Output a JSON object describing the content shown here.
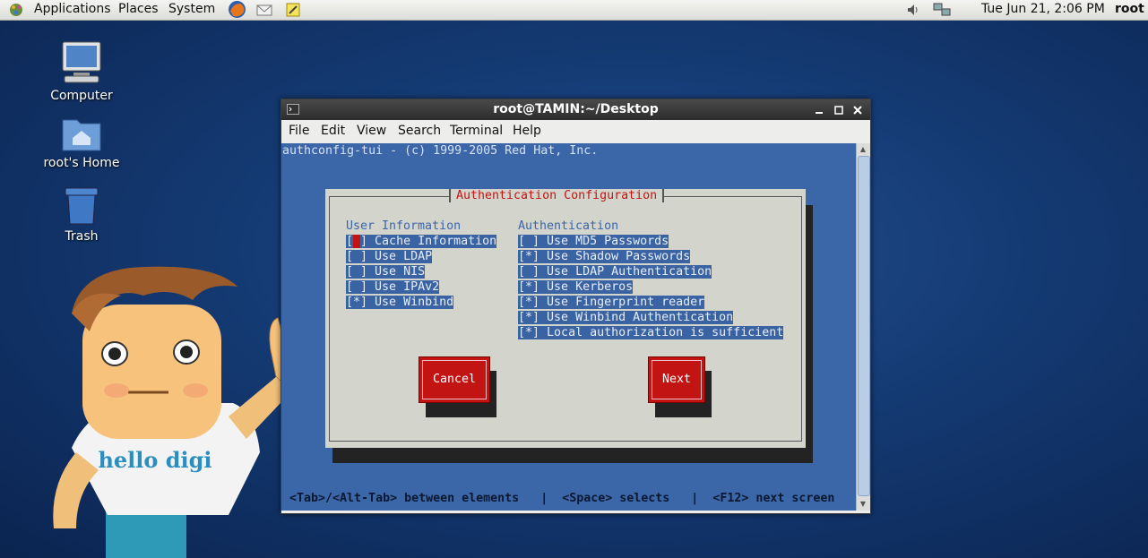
{
  "panel": {
    "menus": [
      "Applications",
      "Places",
      "System"
    ],
    "datetime": "Tue Jun 21,  2:06 PM",
    "user": "root",
    "icons": [
      "gnome-foot-icon",
      "firefox-icon",
      "mail-icon",
      "notes-icon",
      "volume-icon",
      "network-icon"
    ]
  },
  "desktop": {
    "icons": [
      {
        "label": "Computer",
        "icon": "computer-icon"
      },
      {
        "label": "root's Home",
        "icon": "home-folder-icon"
      },
      {
        "label": "Trash",
        "icon": "trash-icon"
      }
    ],
    "mascot_text": "hello digi"
  },
  "window": {
    "title": "root@TAMIN:~/Desktop",
    "menu": [
      "File",
      "Edit",
      "View",
      "Search",
      "Terminal",
      "Help"
    ],
    "controls": [
      "minimize-icon",
      "maximize-icon",
      "close-icon"
    ],
    "terminal_header": "authconfig-tui - (c) 1999-2005 Red Hat, Inc.",
    "dialog": {
      "title": "Authentication Configuration",
      "user_info_heading": "User Information",
      "user_info": [
        {
          "mark": " ",
          "label": "Cache Information"
        },
        {
          "mark": " ",
          "label": "Use LDAP"
        },
        {
          "mark": " ",
          "label": "Use NIS"
        },
        {
          "mark": " ",
          "label": "Use IPAv2"
        },
        {
          "mark": "*",
          "label": "Use Winbind"
        }
      ],
      "auth_heading": "Authentication",
      "auth": [
        {
          "mark": " ",
          "label": "Use MD5 Passwords"
        },
        {
          "mark": "*",
          "label": "Use Shadow Passwords"
        },
        {
          "mark": " ",
          "label": "Use LDAP Authentication"
        },
        {
          "mark": "*",
          "label": "Use Kerberos"
        },
        {
          "mark": "*",
          "label": "Use Fingerprint reader"
        },
        {
          "mark": "*",
          "label": "Use Winbind Authentication"
        },
        {
          "mark": "*",
          "label": "Local authorization is sufficient"
        }
      ],
      "cancel": "Cancel",
      "next": "Next"
    },
    "footer": "<Tab>/<Alt-Tab> between elements   |  <Space> selects   |  <F12> next screen"
  },
  "colors": {
    "accent_red": "#c31414",
    "terminal_blue": "#3b66a8",
    "dialog_gray": "#d3d4cc"
  }
}
